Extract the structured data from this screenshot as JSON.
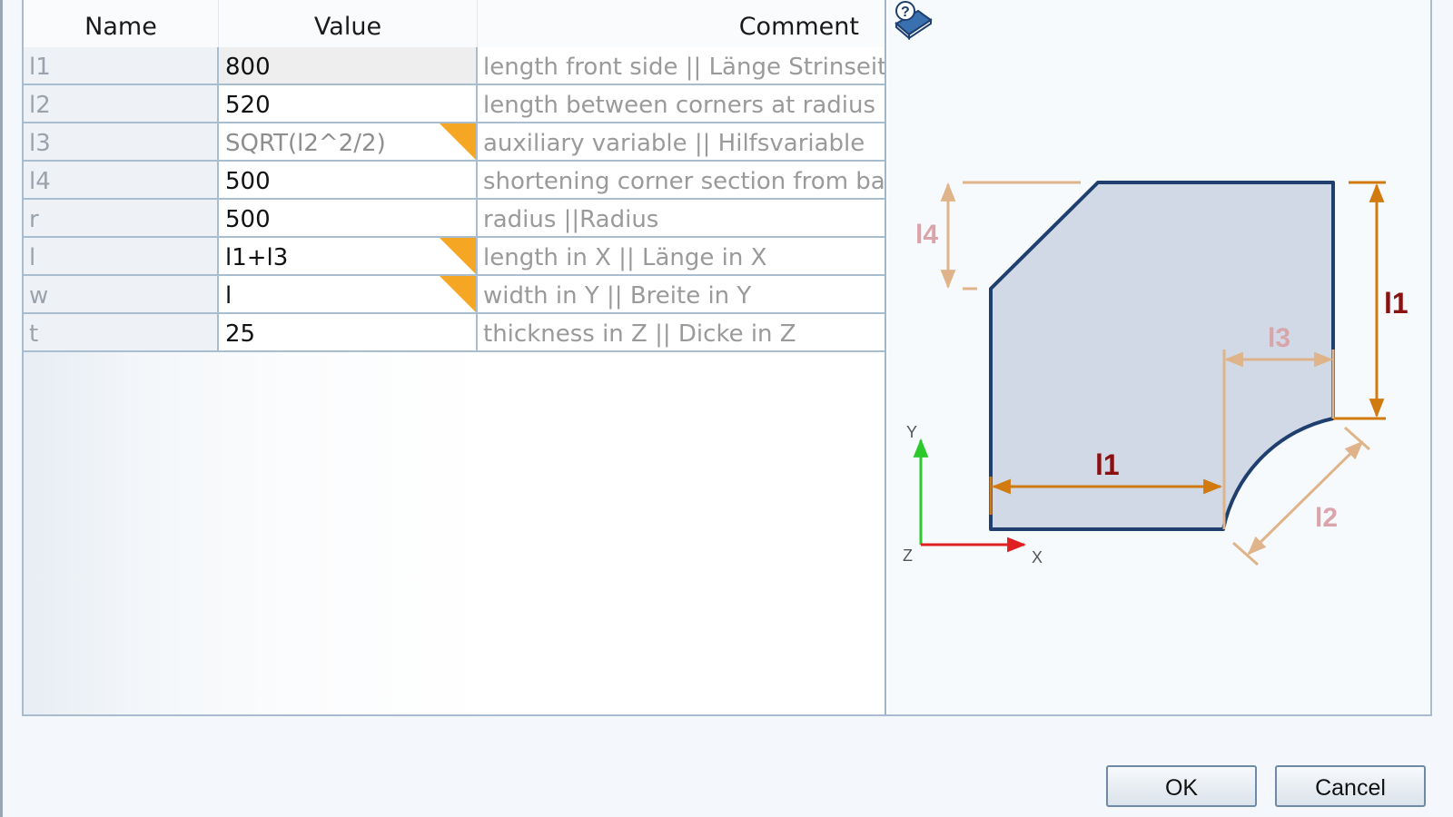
{
  "table": {
    "columns": {
      "name": "Name",
      "value": "Value",
      "comment": "Comment"
    },
    "rows": [
      {
        "name": "l1",
        "value": "800",
        "comment": "length front side || Länge Strinseit",
        "formula": false,
        "selected": true
      },
      {
        "name": "l2",
        "value": "520",
        "comment": "length between corners at radius ||",
        "formula": false
      },
      {
        "name": "l3",
        "value": "SQRT(l2^2/2)",
        "comment": "auxiliary variable || Hilfsvariable",
        "formula": true
      },
      {
        "name": "l4",
        "value": "500",
        "comment": "shortening corner section from ba",
        "formula": false
      },
      {
        "name": "r",
        "value": "500",
        "comment": "radius ||Radius",
        "formula": false
      },
      {
        "name": "l",
        "value": "l1+l3",
        "comment": "length in X || Länge in X",
        "formula": true
      },
      {
        "name": "w",
        "value": "l",
        "comment": "width in Y || Breite in Y",
        "formula": true
      },
      {
        "name": "t",
        "value": "25",
        "comment": "thickness in Z || Dicke in Z",
        "formula": false
      }
    ]
  },
  "diagram": {
    "labels": {
      "l1_bottom": "l1",
      "l1_right": "l1",
      "l2": "l2",
      "l3": "l3",
      "l4": "l4"
    },
    "axes": {
      "x": "X",
      "y": "Y",
      "z": "Z"
    }
  },
  "icons": {
    "help": "help-book-icon",
    "formula_marker": "formula-marker-icon"
  },
  "colors": {
    "formula_marker": "#f5a623",
    "dim_primary": "#d07a10",
    "dim_secondary": "#e0b48a",
    "shape_fill": "#d0d9e5",
    "shape_outline": "#1f3f6e"
  },
  "buttons": {
    "ok": "OK",
    "cancel": "Cancel"
  }
}
